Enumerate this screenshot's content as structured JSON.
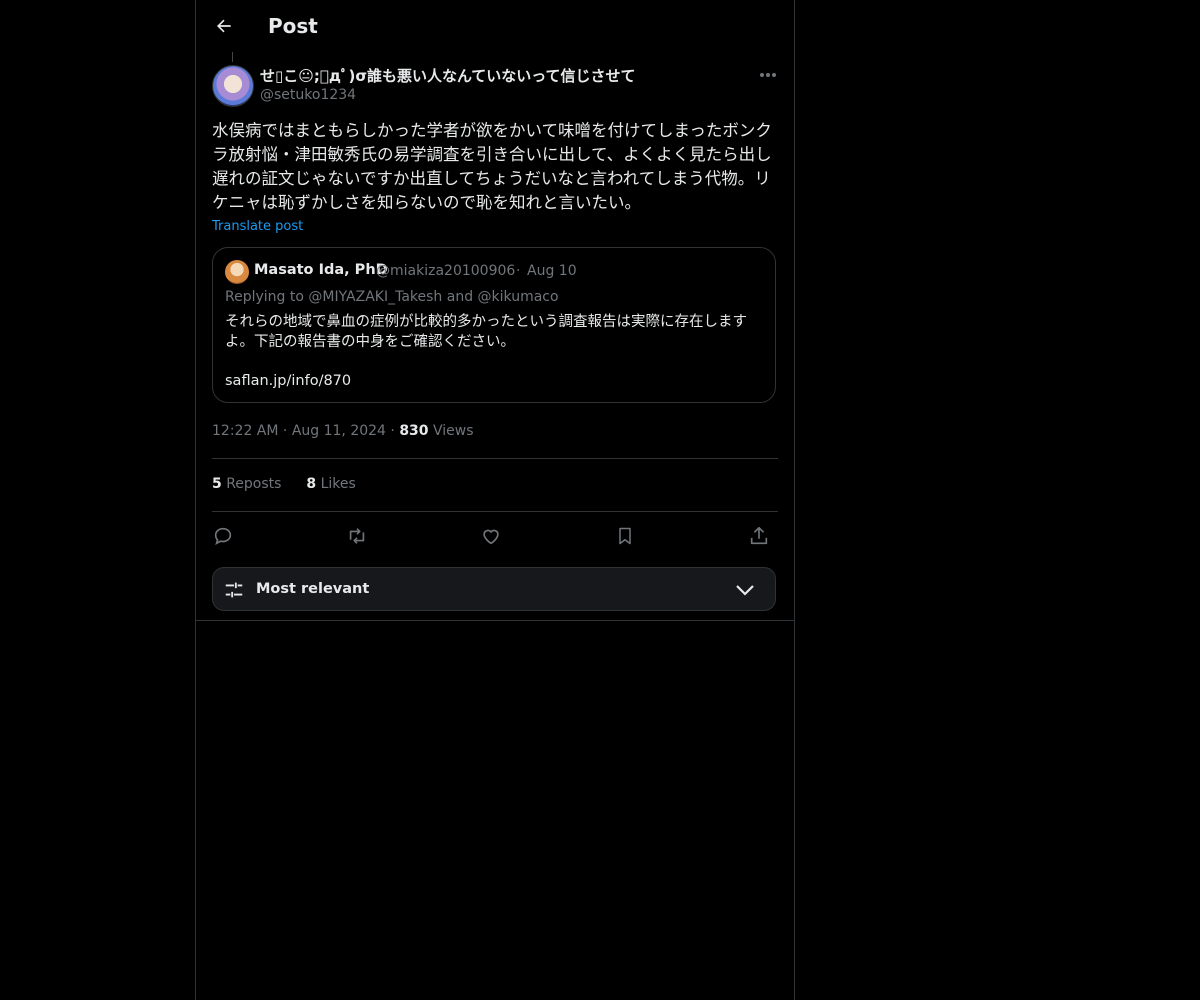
{
  "header": {
    "title": "Post"
  },
  "post": {
    "author_name": "せ▯こ😐;ﾟдﾟ)σ誰も悪い人なんていないって信じさせて",
    "author_handle": "@setuko1234",
    "text": "水俣病ではまともらしかった学者が欲をかいて味噌を付けてしまったボンクラ放射悩・津田敏秀氏の易学調査を引き合いに出して、よくよく見たら出し遅れの証文じゃないですか出直してちょうだいなと言われてしまう代物。リケニャは恥ずかしさを知らないので恥を知れと言いたい。",
    "translate_label": "Translate post",
    "time": "12:22 AM",
    "date": "Aug 11, 2024",
    "views_count": "830",
    "views_label": "Views",
    "reposts_count": "5",
    "reposts_label": "Reposts",
    "likes_count": "8",
    "likes_label": "Likes"
  },
  "quote": {
    "author_name": "Masato Ida, PhD",
    "author_handle": "@miakiza20100906",
    "separator": "·",
    "date": "Aug 10",
    "replying_to": "Replying to @MIYAZAKI_Takesh and @kikumaco",
    "text": "それらの地域で鼻血の症例が比較的多かったという調査報告は実際に存在しますよ。下記の報告書の中身をご確認ください。",
    "link": "saflan.jp/info/870"
  },
  "sort": {
    "label": "Most relevant"
  },
  "icons": {
    "back": "arrow-left-icon",
    "more": "ellipsis-icon",
    "reply": "reply-icon",
    "repost": "repost-icon",
    "like": "heart-icon",
    "bookmark": "bookmark-icon",
    "share": "share-icon",
    "sort": "sliders-icon",
    "chevron": "chevron-down-icon"
  },
  "colors": {
    "background": "#000000",
    "text": "#e7e9ea",
    "muted": "#71767b",
    "accent": "#1d9bf0",
    "border": "#2f3336"
  }
}
